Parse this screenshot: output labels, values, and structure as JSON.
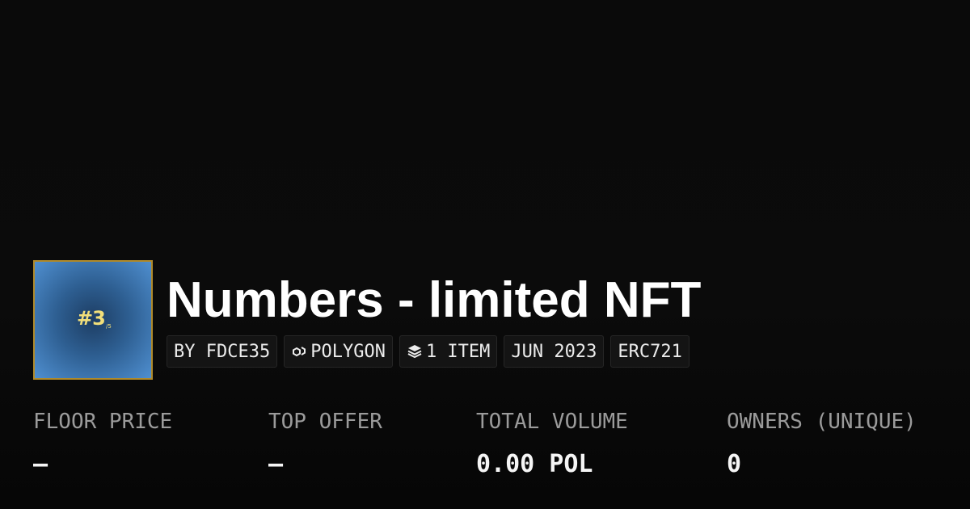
{
  "collection": {
    "thumbnail_text": "#3",
    "thumbnail_subtext": "/5",
    "title": "Numbers - limited NFT"
  },
  "tags": [
    {
      "label": "BY FDCE35",
      "icon": null
    },
    {
      "label": "POLYGON",
      "icon": "polygon-icon"
    },
    {
      "label": "1 ITEM",
      "icon": "layers-icon"
    },
    {
      "label": "JUN 2023",
      "icon": null
    },
    {
      "label": "ERC721",
      "icon": null
    }
  ],
  "stats": [
    {
      "label": "FLOOR PRICE",
      "value": "–"
    },
    {
      "label": "TOP OFFER",
      "value": "–"
    },
    {
      "label": "TOTAL VOLUME",
      "value": "0.00 POL"
    },
    {
      "label": "OWNERS (UNIQUE)",
      "value": "0"
    }
  ],
  "colors": {
    "background": "#0a0a0a",
    "thumbnail_border": "#b08a2a",
    "thumbnail_blue": "#4f8fd0",
    "thumbnail_text": "#f2df7a",
    "label_gray": "#9b9b9b"
  }
}
